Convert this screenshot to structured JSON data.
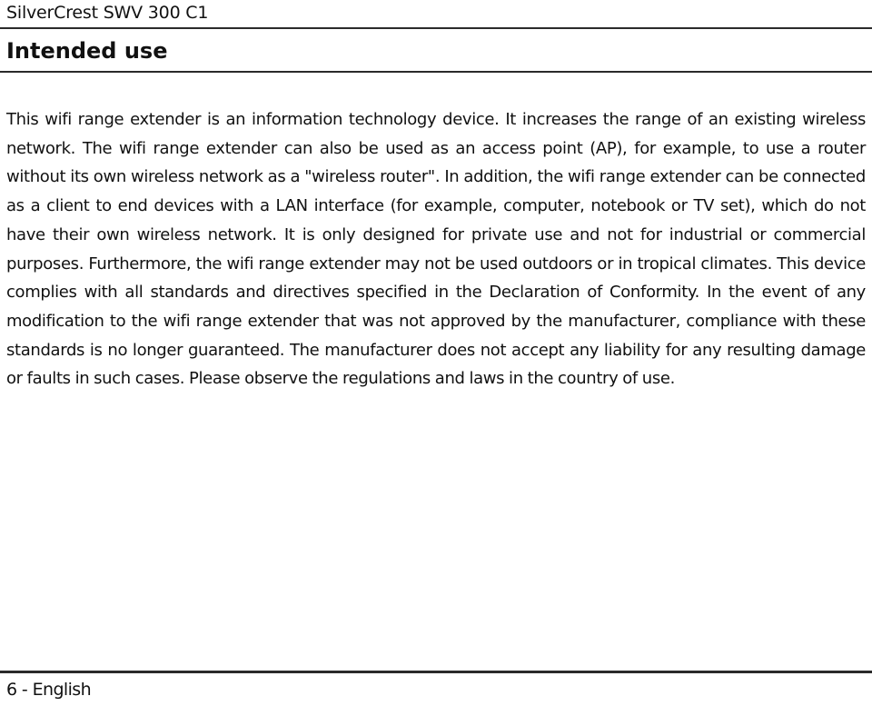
{
  "header": {
    "product": "SilverCrest SWV 300 C1"
  },
  "section": {
    "title": "Intended use",
    "body": "This wifi range extender is an information technology device. It increases the range of an existing wireless network. The wifi range extender can also be used as an access point (AP), for example, to use a router without its own wireless network as a \"wireless router\". In addition, the wifi range extender can be connected as a client to end devices with a LAN interface (for example, computer, notebook or TV set), which do not have their own wireless network. It is only designed for private use and not for industrial or commercial purposes. Furthermore, the wifi range extender may not be used outdoors or in tropical climates. This device complies with all standards and directives specified in the Declaration of Conformity. In the event of any modification to the wifi range extender that was not approved by the manufacturer, compliance with these standards is no longer guaranteed. The manufacturer does not accept any liability for any resulting damage or faults in such cases. Please observe the regulations and laws in the country of use."
  },
  "footer": {
    "page_label": "6 - English"
  }
}
